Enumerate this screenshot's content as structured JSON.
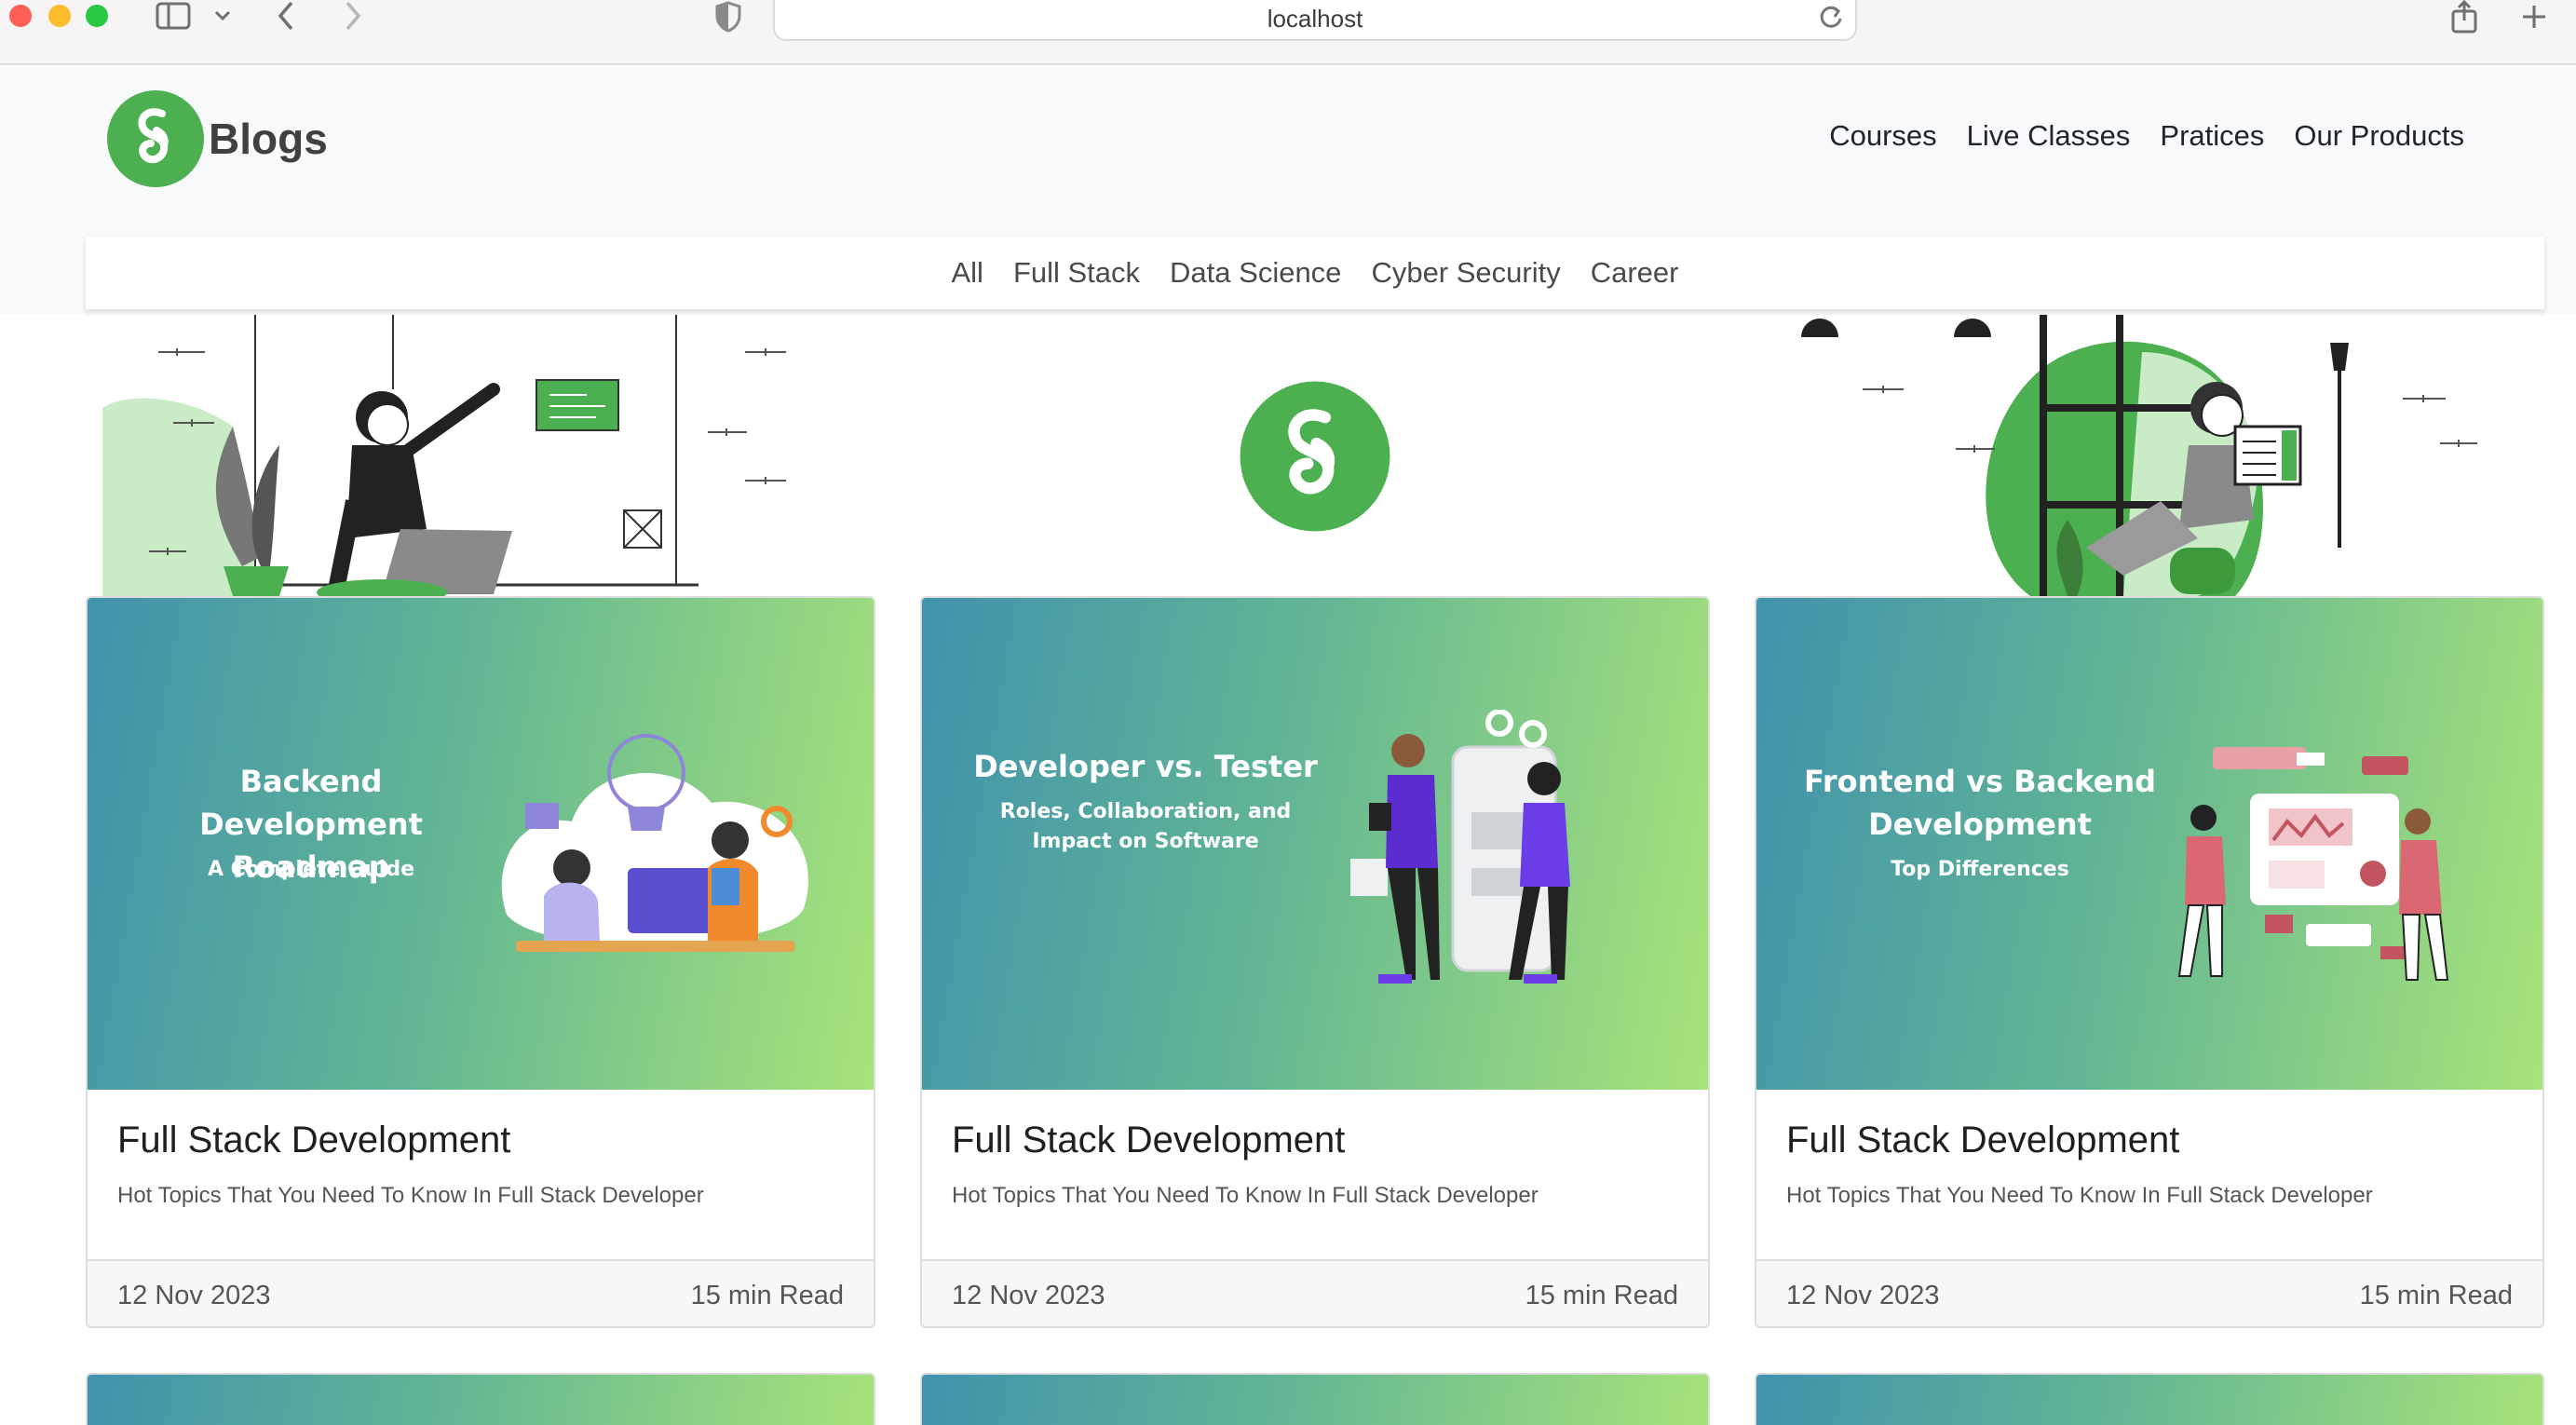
{
  "browser": {
    "url": "localhost"
  },
  "site": {
    "brand": "Blogs",
    "nav": [
      "Courses",
      "Live Classes",
      "Pratices",
      "Our Products"
    ],
    "categories": [
      "All",
      "Full Stack",
      "Data Science",
      "Cyber Security",
      "Career"
    ],
    "accent_color": "#4caf50"
  },
  "cards": [
    {
      "banner_title": "Backend Development Roadmap",
      "banner_sub": "A Complete Guide",
      "title": "Full Stack Development",
      "description": "Hot Topics That You Need To Know In Full Stack Developer",
      "date": "12 Nov 2023",
      "read_time": "15 min Read"
    },
    {
      "banner_title": "Developer vs. Tester",
      "banner_sub": "Roles, Collaboration, and Impact on Software",
      "title": "Full Stack Development",
      "description": "Hot Topics That You Need To Know In Full Stack Developer",
      "date": "12 Nov 2023",
      "read_time": "15 min Read"
    },
    {
      "banner_title": "Frontend vs Backend Development",
      "banner_sub": "Top Differences",
      "title": "Full Stack Development",
      "description": "Hot Topics That You Need To Know In Full Stack Developer",
      "date": "12 Nov 2023",
      "read_time": "15 min Read"
    }
  ]
}
